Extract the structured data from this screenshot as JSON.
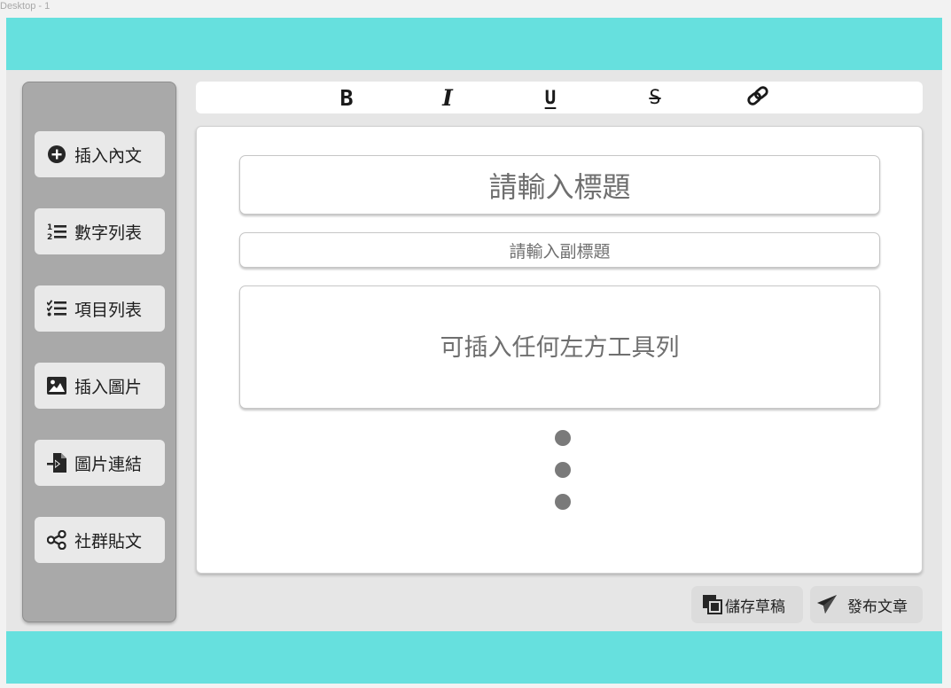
{
  "frame_label": "Desktop - 1",
  "toolbar": {
    "buttons": [
      {
        "name": "bold",
        "glyph": "B"
      },
      {
        "name": "italic",
        "glyph": "I"
      },
      {
        "name": "underline",
        "glyph": "U"
      },
      {
        "name": "strikethrough",
        "glyph": "S"
      },
      {
        "name": "link",
        "icon": "link-icon"
      }
    ]
  },
  "sidebar": {
    "items": [
      {
        "label": "插入內文",
        "icon": "plus-circle-icon"
      },
      {
        "label": "數字列表",
        "icon": "numbered-list-icon"
      },
      {
        "label": "項目列表",
        "icon": "checklist-icon"
      },
      {
        "label": "插入圖片",
        "icon": "image-icon"
      },
      {
        "label": "圖片連結",
        "icon": "file-import-icon"
      },
      {
        "label": "社群貼文",
        "icon": "share-icon"
      }
    ]
  },
  "editor": {
    "title_placeholder": "請輸入標題",
    "subtitle_placeholder": "請輸入副標題",
    "body_placeholder": "可插入任何左方工具列"
  },
  "actions": {
    "save_draft": "儲存草稿",
    "publish": "發布文章"
  },
  "colors": {
    "accent_bar": "#66e0de",
    "sidebar": "#a9a9a9",
    "canvas": "#e6e6e6"
  }
}
